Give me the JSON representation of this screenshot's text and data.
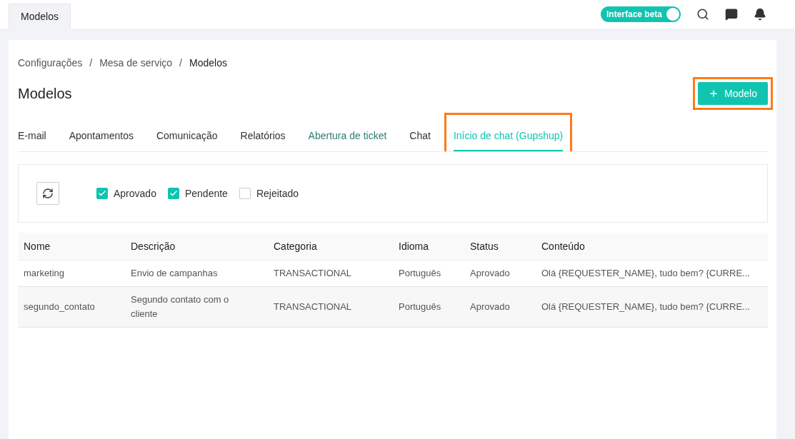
{
  "top_tab": {
    "label": "Modelos",
    "selected": true
  },
  "beta_toggle": {
    "label": "Interface beta",
    "on": true
  },
  "breadcrumb": {
    "separator": "/",
    "items": [
      "Configurações",
      "Mesa de serviço",
      "Modelos"
    ]
  },
  "page_title": "Modelos",
  "new_button": {
    "label": "Modelo",
    "highlighted": true
  },
  "tabs": [
    {
      "label": "E-mail",
      "selected": false,
      "hovered": false,
      "highlighted": false
    },
    {
      "label": "Apontamentos",
      "selected": false,
      "hovered": false,
      "highlighted": false
    },
    {
      "label": "Comunicação",
      "selected": false,
      "hovered": false,
      "highlighted": false
    },
    {
      "label": "Relatórios",
      "selected": false,
      "hovered": false,
      "highlighted": false
    },
    {
      "label": "Abertura de ticket",
      "selected": false,
      "hovered": true,
      "highlighted": false
    },
    {
      "label": "Chat",
      "selected": false,
      "hovered": false,
      "highlighted": false
    },
    {
      "label": "Início de chat (Gupshup)",
      "selected": true,
      "hovered": false,
      "highlighted": true
    }
  ],
  "filters": [
    {
      "label": "Aprovado",
      "checked": true
    },
    {
      "label": "Pendente",
      "checked": true
    },
    {
      "label": "Rejeitado",
      "checked": false
    }
  ],
  "table": {
    "columns": [
      "Nome",
      "Descrição",
      "Categoria",
      "Idioma",
      "Status",
      "Conteúdo"
    ],
    "rows": [
      {
        "cells": [
          "marketing",
          "Envio de campanhas",
          "TRANSACTIONAL",
          "Português",
          "Aprovado",
          "Olá {REQUESTER_NAME}, tudo bem? {CURRE..."
        ]
      },
      {
        "cells": [
          "segundo_contato",
          "Segundo contato com o cliente",
          "TRANSACTIONAL",
          "Português",
          "Aprovado",
          "Olá {REQUESTER_NAME}, tudo bem? {CURRE..."
        ]
      }
    ]
  }
}
